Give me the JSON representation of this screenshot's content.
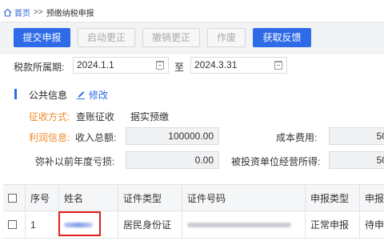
{
  "breadcrumb": {
    "home": "首页",
    "separator": ">>",
    "current": "预缴纳税申报"
  },
  "toolbar": {
    "submit": "提交申报",
    "start_correction": "启动更正",
    "cancel_correction": "撤销更正",
    "void": "作废",
    "get_feedback": "获取反馈"
  },
  "period": {
    "label": "税款所属期:",
    "start": "2024.1.1",
    "to": "至",
    "end": "2024.3.31"
  },
  "section": {
    "title": "公共信息",
    "edit": "修改"
  },
  "info": {
    "collection_method_label": "征收方式:",
    "collection_method_value": "查账征收",
    "prepay_basis": "据实预缴",
    "profit_info_label": "利润信息:",
    "income_total_label": "收入总额:",
    "income_total_value": "100000.00",
    "cost_expense_label": "成本费用:",
    "cost_expense_value": "50",
    "loss_label": "弥补以前年度亏损:",
    "loss_value": "0.00",
    "investee_income_label": "被投资单位经营所得:",
    "investee_income_value": "50"
  },
  "table": {
    "headers": [
      "序号",
      "姓名",
      "证件类型",
      "证件号码",
      "申报类型",
      "申报状"
    ],
    "rows": [
      {
        "index": "1",
        "id_type": "居民身份证",
        "declare_type": "正常申报",
        "status": "待申报"
      }
    ]
  },
  "colors": {
    "primary": "#2e6be6",
    "orange": "#f08a2c",
    "highlight": "#e02020"
  }
}
